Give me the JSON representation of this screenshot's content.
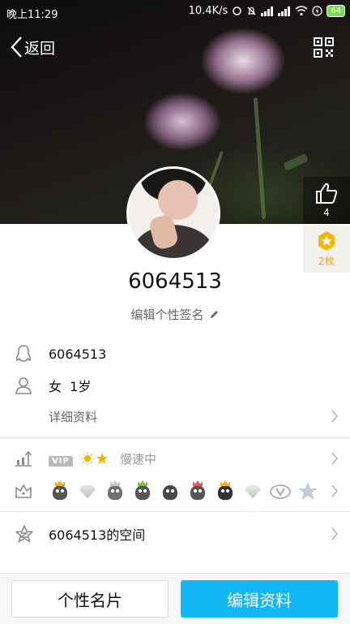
{
  "status_bar": {
    "time": "晚上11:29",
    "network_speed": "10.4K/s",
    "battery": "64"
  },
  "header": {
    "back_label": "返回"
  },
  "profile": {
    "nickname": "6064513",
    "signature_placeholder": "编辑个性签名",
    "like_count": "4",
    "coin_label": "2枚"
  },
  "info": {
    "qq_number": "6064513",
    "gender_age": "女  1岁",
    "details_link": "详细资料"
  },
  "vip": {
    "badge": "VIP",
    "status": "慢速中"
  },
  "space": {
    "label": "6064513的空间"
  },
  "footer": {
    "card_button": "个性名片",
    "edit_button": "编辑资料"
  },
  "colors": {
    "accent": "#12b7f5",
    "coin": "#f0a800"
  }
}
